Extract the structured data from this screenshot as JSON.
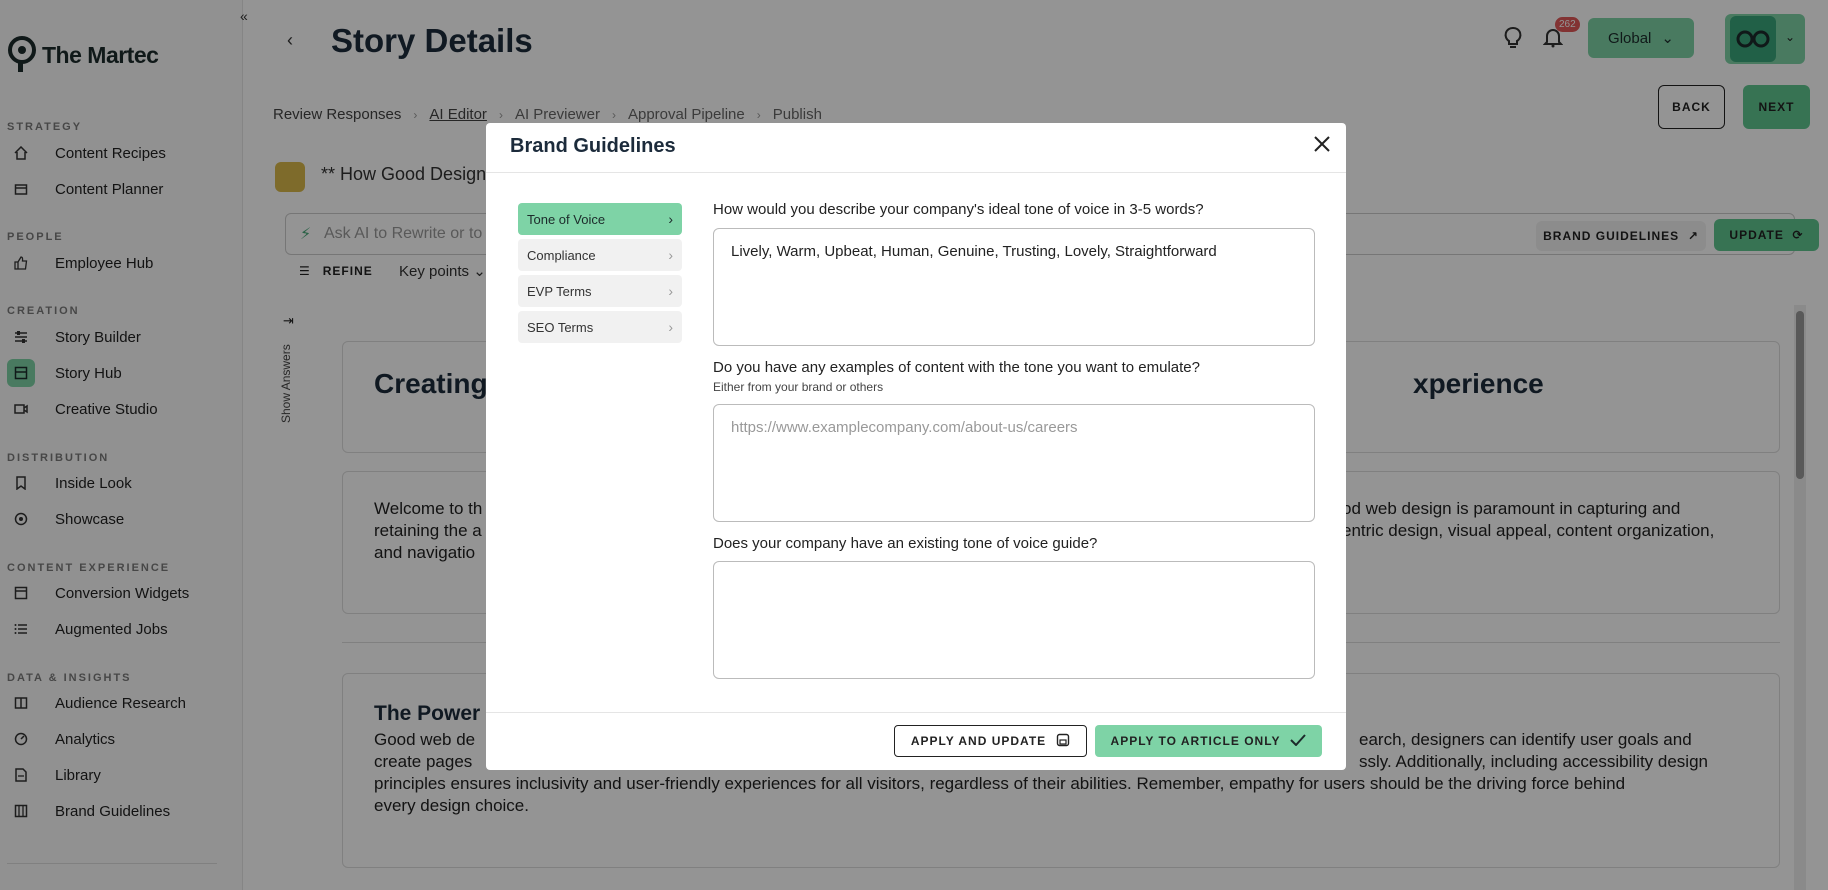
{
  "brand": {
    "name": "The Martec"
  },
  "sidebar": {
    "sections": [
      {
        "label": "STRATEGY"
      },
      {
        "label": "PEOPLE"
      },
      {
        "label": "CREATION"
      },
      {
        "label": "DISTRIBUTION"
      },
      {
        "label": "CONTENT EXPERIENCE"
      },
      {
        "label": "DATA & INSIGHTS"
      }
    ],
    "items": [
      {
        "label": "Content Recipes",
        "icon": "home-icon"
      },
      {
        "label": "Content Planner",
        "icon": "calendar-icon"
      },
      {
        "label": "Employee Hub",
        "icon": "thumbs-up-icon"
      },
      {
        "label": "Story Builder",
        "icon": "sliders-icon"
      },
      {
        "label": "Story Hub",
        "icon": "archive-icon",
        "active": true
      },
      {
        "label": "Creative Studio",
        "icon": "camera-icon"
      },
      {
        "label": "Inside Look",
        "icon": "bookmark-icon"
      },
      {
        "label": "Showcase",
        "icon": "target-icon"
      },
      {
        "label": "Conversion Widgets",
        "icon": "layout-icon"
      },
      {
        "label": "Augmented Jobs",
        "icon": "list-icon"
      },
      {
        "label": "Audience Research",
        "icon": "book-icon"
      },
      {
        "label": "Analytics",
        "icon": "gauge-icon"
      },
      {
        "label": "Library",
        "icon": "library-icon"
      },
      {
        "label": "Brand Guidelines",
        "icon": "palette-icon"
      }
    ]
  },
  "header": {
    "title": "Story Details",
    "notification_count": "262",
    "region": "Global"
  },
  "steps": [
    "Review Responses",
    "AI Editor",
    "AI Previewer",
    "Approval Pipeline",
    "Publish"
  ],
  "actions": {
    "back": "BACK",
    "next": "NEXT"
  },
  "story": {
    "title": "** How Good Design"
  },
  "ai_bar": {
    "placeholder": "Ask AI to Rewrite or to",
    "brand_guidelines": "BRAND GUIDELINES",
    "update": "UPDATE"
  },
  "toolbar": {
    "refine": "REFINE",
    "key_points": "Key points"
  },
  "show_answers": "Show Answers",
  "content": {
    "heading_left": "Creating",
    "heading_right": "xperience",
    "para1_line1_left": "Welcome to th",
    "para1_line1_right": "od web design is paramount in capturing and",
    "para1_line2_left": "retaining the a",
    "para1_line2_right": "entric design, visual appeal, content organization,",
    "para1_line3_left": "and navigatio",
    "section_heading": "The Power",
    "para2_line1_left": "Good web de",
    "para2_line1_right": "earch, designers can identify user goals and",
    "para2_line2_left": "create pages",
    "para2_line2_right": "ssly. Additionally, including accessibility design",
    "para2_line3": "principles ensures inclusivity and user-friendly experiences for all visitors, regardless of their abilities. Remember, empathy for users should be the driving force behind",
    "para2_line4": "every design choice."
  },
  "modal": {
    "title": "Brand Guidelines",
    "tabs": [
      "Tone of Voice",
      "Compliance",
      "EVP Terms",
      "SEO Terms"
    ],
    "q1": "How would you describe your company's ideal tone of voice in 3-5 words?",
    "q1_value": "Lively, Warm, Upbeat, Human, Genuine, Trusting, Lovely, Straightforward",
    "q2": "Do you have any examples of content with the tone you want to emulate?",
    "q2_sub": "Either from your brand or others",
    "q2_placeholder": "https://www.examplecompany.com/about-us/careers",
    "q3": "Does your company have an existing tone of voice guide?",
    "q3_value": "",
    "apply_update": "APPLY AND UPDATE",
    "apply_article": "APPLY TO ARTICLE ONLY"
  },
  "colors": {
    "accent": "#7ed3a6",
    "accent_dark": "#5fc690",
    "title": "#1c2b3b",
    "badge": "#e05858"
  }
}
